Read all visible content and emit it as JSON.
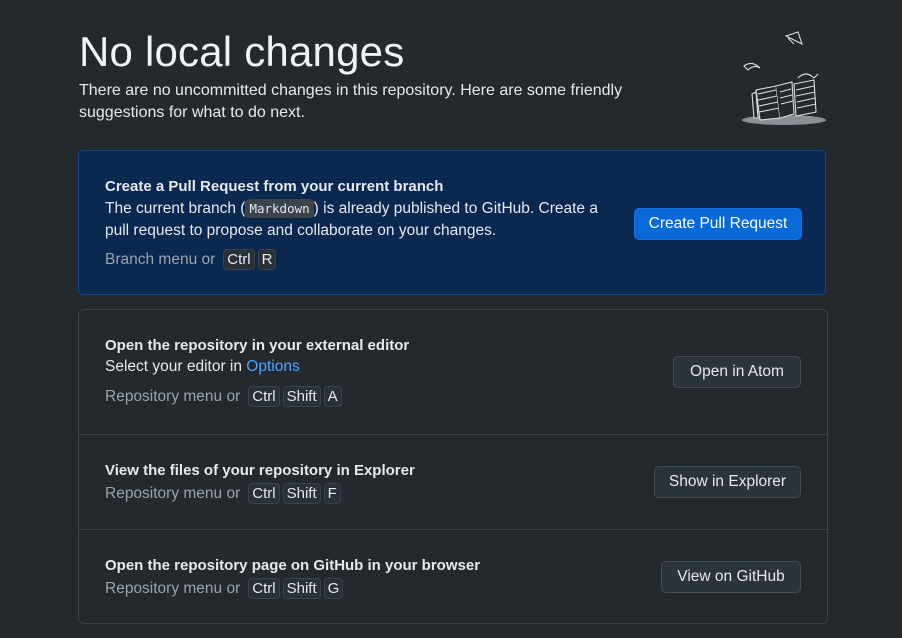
{
  "header": {
    "title": "No local changes",
    "subtitle": "There are no uncommitted changes in this repository. Here are some friendly suggestions for what to do next."
  },
  "pull_request": {
    "title": "Create a Pull Request from your current branch",
    "desc_before": "The current branch (",
    "branch": "Markdown",
    "desc_after": ") is already published to GitHub. Create a pull request to propose and collaborate on your changes.",
    "menu_text": "Branch menu or",
    "keys": [
      "Ctrl",
      "R"
    ],
    "button": "Create Pull Request"
  },
  "editor": {
    "title": "Open the repository in your external editor",
    "desc_before": "Select your editor in ",
    "desc_link": "Options",
    "menu_text": "Repository menu or",
    "keys": [
      "Ctrl",
      "Shift",
      "A"
    ],
    "button": "Open in Atom"
  },
  "explorer": {
    "title": "View the files of your repository in Explorer",
    "menu_text": "Repository menu or",
    "keys": [
      "Ctrl",
      "Shift",
      "F"
    ],
    "button": "Show in Explorer"
  },
  "github": {
    "title": "Open the repository page on GitHub in your browser",
    "menu_text": "Repository menu or",
    "keys": [
      "Ctrl",
      "Shift",
      "G"
    ],
    "button": "View on GitHub"
  },
  "colors": {
    "background": "#24292e",
    "primary_card": "#0b2850",
    "accent_button": "#0869d8",
    "link": "#4ba5ff"
  }
}
